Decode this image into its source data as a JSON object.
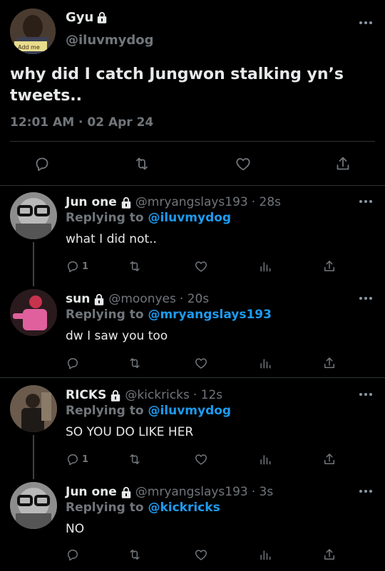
{
  "main_tweet": {
    "name": "Gyu",
    "handle": "@iluvmydog",
    "avatar_text": "Add me",
    "text": "why did I catch Jungwon stalking yn’s tweets..",
    "timestamp": "12:01 AM · 02 Apr 24"
  },
  "replies": [
    {
      "name": "Jun one",
      "handle": "@mryangslays193",
      "time": "· 28s",
      "replying_prefix": "Replying to",
      "replying_to": "@iluvmydog",
      "text": "what I did not..",
      "reply_count": "1"
    },
    {
      "name": "sun",
      "handle": "@moonyes",
      "time": "· 20s",
      "replying_prefix": "Replying to",
      "replying_to": "@mryangslays193",
      "text": "dw I saw you too",
      "reply_count": ""
    },
    {
      "name": "RICKS",
      "handle": "@kickricks",
      "time": "· 12s",
      "replying_prefix": "Replying to",
      "replying_to": "@iluvmydog",
      "text": "SO YOU DO LIKE HER",
      "reply_count": "1"
    },
    {
      "name": "Jun one",
      "handle": "@mryangslays193",
      "time": "· 3s",
      "replying_prefix": "Replying to",
      "replying_to": "@kickricks",
      "text": "NO",
      "reply_count": ""
    }
  ],
  "colors": {
    "background": "#000000",
    "text": "#e7e9ea",
    "secondary": "#71767b",
    "link": "#1d9bf0",
    "divider": "#2f3336"
  },
  "icons": [
    "lock-icon",
    "more-icon",
    "reply-icon",
    "retweet-icon",
    "like-icon",
    "views-icon",
    "share-icon"
  ]
}
